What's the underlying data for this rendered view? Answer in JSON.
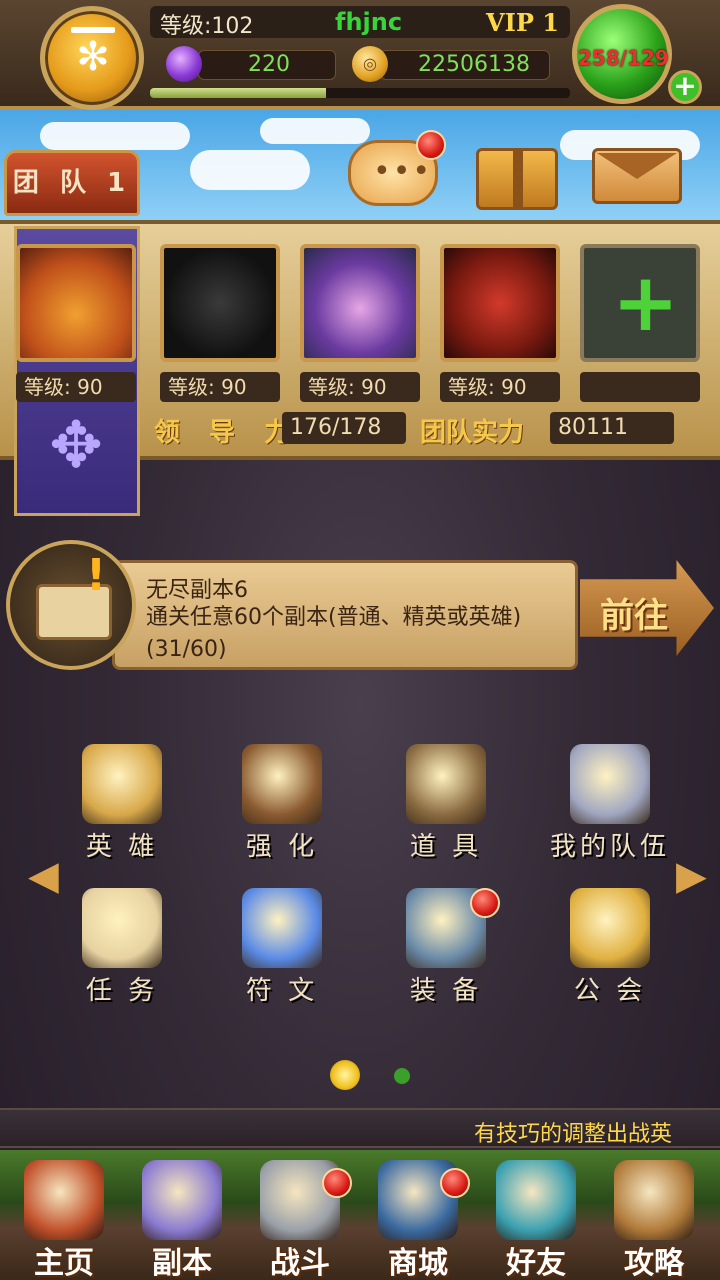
{
  "player": {
    "level_label": "等级:102",
    "name": "fhjnc",
    "vip": "VIP 1",
    "gems": "220",
    "gold": "22506138",
    "stamina": "258/129",
    "xp_progress": 0.42
  },
  "team": {
    "tab_label": "团 队 1",
    "heroes": [
      {
        "level": "等级: 90"
      },
      {
        "level": "等级: 90"
      },
      {
        "level": "等级: 90"
      },
      {
        "level": "等级: 90"
      },
      {
        "level": ""
      }
    ],
    "leadership_label": "领 导 力",
    "leadership_value": "176/178",
    "power_label": "团队实力",
    "power_value": "80111"
  },
  "quest": {
    "title": "无尽副本6",
    "description": "通关任意60个副本(普通、精英或英雄)(31/60)",
    "go_label": "前往"
  },
  "menu": [
    {
      "label": "英 雄",
      "icon": "hero-book-icon",
      "badge": false
    },
    {
      "label": "强 化",
      "icon": "helmet-icon",
      "badge": false
    },
    {
      "label": "道 具",
      "icon": "backpack-icon",
      "badge": false
    },
    {
      "label": "我的队伍",
      "icon": "crossed-swords-icon",
      "badge": false
    },
    {
      "label": "任 务",
      "icon": "scroll-icon",
      "badge": false
    },
    {
      "label": "符 文",
      "icon": "rune-gem-icon",
      "badge": false
    },
    {
      "label": "装 备",
      "icon": "anvil-icon",
      "badge": true
    },
    {
      "label": "公 会",
      "icon": "guild-shield-icon",
      "badge": false
    }
  ],
  "ticker": "有技巧的调整出战英",
  "pager": {
    "pages": 2,
    "current": 1
  },
  "nav": [
    {
      "label": "主页",
      "icon": "house-icon",
      "badge": false
    },
    {
      "label": "副本",
      "icon": "skull-icon",
      "badge": false
    },
    {
      "label": "战斗",
      "icon": "sword-icon",
      "badge": true
    },
    {
      "label": "商城",
      "icon": "monster-shop-icon",
      "badge": true
    },
    {
      "label": "好友",
      "icon": "friends-icon",
      "badge": false
    },
    {
      "label": "攻略",
      "icon": "guide-book-icon",
      "badge": false
    }
  ],
  "colors": {
    "accent": "#ffd84a",
    "level_green": "#37d43a",
    "badge_red": "#d81a14"
  }
}
